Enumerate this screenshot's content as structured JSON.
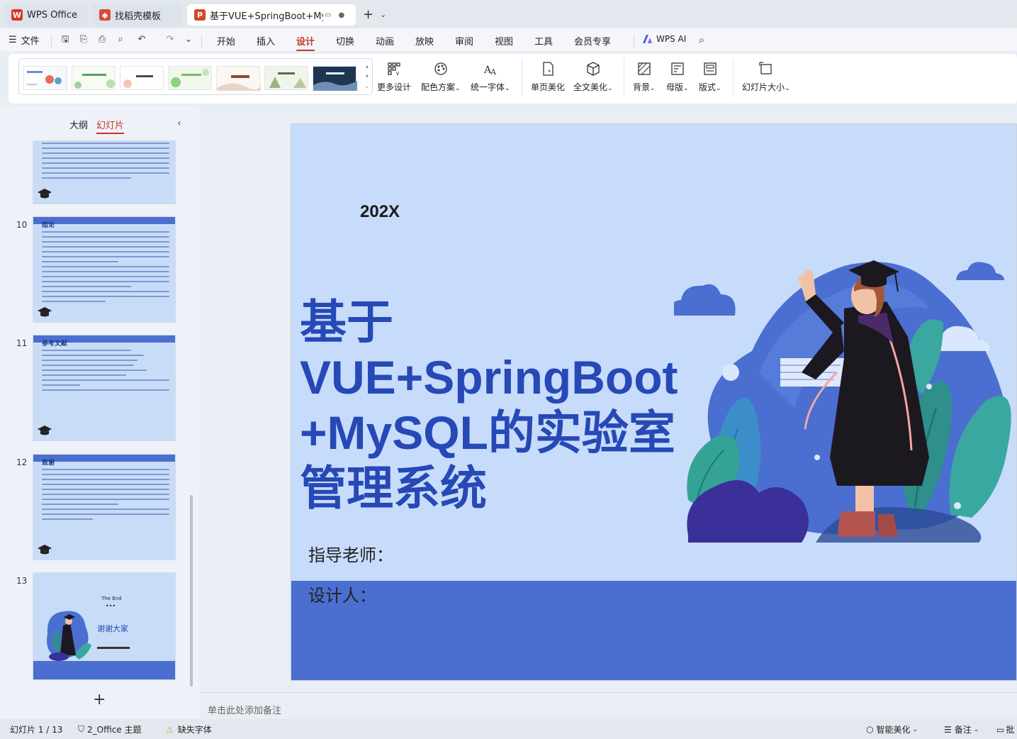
{
  "tabs": [
    {
      "label": "WPS Office",
      "icon": "wps-logo-icon"
    },
    {
      "label": "找稻壳模板",
      "icon": "docer-logo-icon"
    },
    {
      "label": "基于VUE+SpringBoot+MyS(",
      "icon": "presentation-file-icon"
    }
  ],
  "menu": {
    "file_label": "文件",
    "items": [
      "开始",
      "插入",
      "设计",
      "切换",
      "动画",
      "放映",
      "审阅",
      "视图",
      "工具",
      "会员专享"
    ],
    "active": "设计",
    "wps_ai_label": "WPS AI"
  },
  "ribbon": {
    "more_design": "更多设计",
    "color_scheme": "配色方案",
    "unify_font": "统一字体",
    "page_beautify": "单页美化",
    "full_beautify": "全文美化",
    "background": "背景",
    "master": "母版",
    "layout": "版式",
    "slide_size": "幻灯片大小"
  },
  "left_panel": {
    "tab_outline": "大纲",
    "tab_slides": "幻灯片",
    "slides": [
      {
        "num": "",
        "title": ""
      },
      {
        "num": "10",
        "title": "结论"
      },
      {
        "num": "11",
        "title": "参考文献"
      },
      {
        "num": "12",
        "title": "致谢"
      },
      {
        "num": "13",
        "title": "The End",
        "subtitle": "谢谢大家"
      }
    ]
  },
  "slide": {
    "year": "202X",
    "title_line1": "基于",
    "title_line2": "VUE+SpringBoot",
    "title_line3": "+MySQL的实验室",
    "title_line4": "管理系统",
    "teacher_label": "指导老师：",
    "designer_label": "设计人："
  },
  "notes_placeholder": "单击此处添加备注",
  "status": {
    "slide_counter": "幻灯片 1 / 13",
    "theme": "2_Office 主题",
    "missing_font": "缺失字体",
    "smart_beautify": "智能美化",
    "notes": "备注",
    "comment": "批"
  },
  "colors": {
    "accent_red": "#c8342a",
    "slide_bg": "#c7dcfb",
    "slide_band": "#4a6fd0",
    "title_blue": "#2749b6"
  }
}
